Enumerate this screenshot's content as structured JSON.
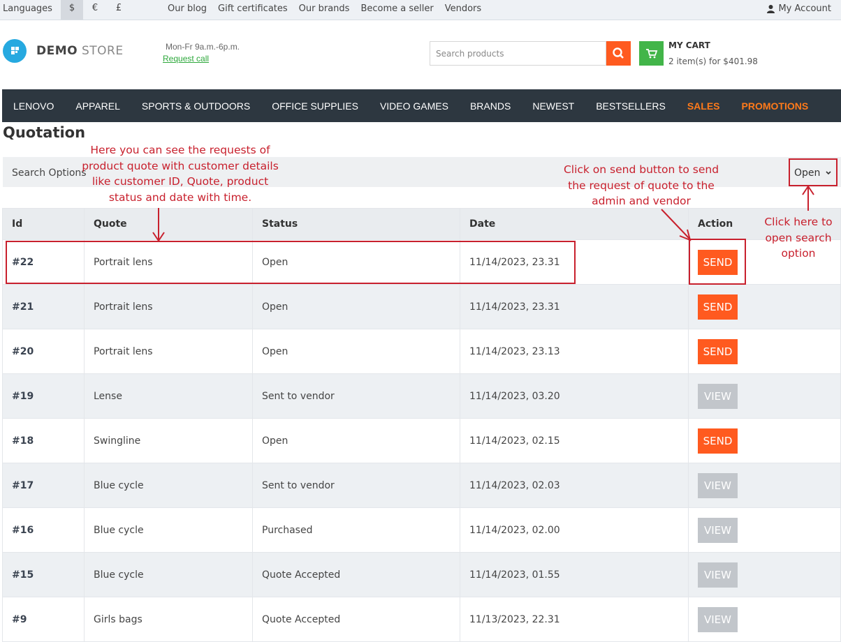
{
  "topbar": {
    "languages": "Languages",
    "currencies": [
      "$",
      "€",
      "£"
    ],
    "links": [
      "Our blog",
      "Gift certificates",
      "Our brands",
      "Become a seller",
      "Vendors"
    ],
    "account": "My Account"
  },
  "header": {
    "logo_bold": "DEMO",
    "logo_light": "STORE",
    "hours": "Mon-Fr 9a.m.-6p.m.",
    "request_call": "Request call",
    "search_placeholder": "Search products",
    "cart_title": "MY CART",
    "cart_summary": "2 item(s) for $401.98"
  },
  "nav": [
    "LENOVO",
    "APPAREL",
    "SPORTS & OUTDOORS",
    "OFFICE SUPPLIES",
    "VIDEO GAMES",
    "BRANDS",
    "NEWEST",
    "BESTSELLERS",
    "SALES",
    "PROMOTIONS"
  ],
  "page_title": "Quotation",
  "search_options": {
    "label": "Search Options",
    "dropdown": "Open"
  },
  "table": {
    "headers": [
      "Id",
      "Quote",
      "Status",
      "Date",
      "Action"
    ],
    "rows": [
      {
        "id": "#22",
        "quote": "Portrait lens",
        "status": "Open",
        "date": "11/14/2023, 23.31",
        "action": "SEND"
      },
      {
        "id": "#21",
        "quote": "Portrait lens",
        "status": "Open",
        "date": "11/14/2023, 23.31",
        "action": "SEND"
      },
      {
        "id": "#20",
        "quote": "Portrait lens",
        "status": "Open",
        "date": "11/14/2023, 23.13",
        "action": "SEND"
      },
      {
        "id": "#19",
        "quote": "Lense",
        "status": "Sent to vendor",
        "date": "11/14/2023, 03.20",
        "action": "VIEW"
      },
      {
        "id": "#18",
        "quote": "Swingline",
        "status": "Open",
        "date": "11/14/2023, 02.15",
        "action": "SEND"
      },
      {
        "id": "#17",
        "quote": "Blue cycle",
        "status": "Sent to vendor",
        "date": "11/14/2023, 02.03",
        "action": "VIEW"
      },
      {
        "id": "#16",
        "quote": "Blue cycle",
        "status": "Purchased",
        "date": "11/14/2023, 02.00",
        "action": "VIEW"
      },
      {
        "id": "#15",
        "quote": "Blue cycle",
        "status": "Quote Accepted",
        "date": "11/14/2023, 01.55",
        "action": "VIEW"
      },
      {
        "id": "#9",
        "quote": "Girls bags",
        "status": "Quote Accepted",
        "date": "11/13/2023, 22.31",
        "action": "VIEW"
      }
    ]
  },
  "annotations": {
    "left": "Here you can see the requests of product quote with customer details like customer ID, Quote, product status and date with time.",
    "middle": "Click on send button to send the request of quote to the admin and vendor",
    "right": "Click here to open search option"
  },
  "colors": {
    "accent_orange": "#ff5a1f",
    "nav_bg": "#2d3740",
    "cart_green": "#42b549",
    "annotation_red": "#c8202d"
  }
}
